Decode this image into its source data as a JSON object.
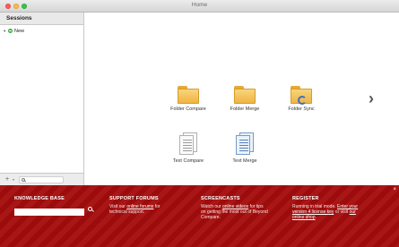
{
  "window": {
    "title": "Home"
  },
  "sidebar": {
    "header": "Sessions",
    "tree": [
      {
        "label": "New",
        "expanded": true
      }
    ],
    "bottom": {
      "add_label": "+",
      "search_placeholder": ""
    }
  },
  "launcher": {
    "items": [
      {
        "label": "Folder Compare",
        "icon": "folder-icon"
      },
      {
        "label": "Folder Merge",
        "icon": "folder-icon"
      },
      {
        "label": "Folder Sync",
        "icon": "folder-sync-icon"
      },
      {
        "label": "Text Compare",
        "icon": "text-doc-icon"
      },
      {
        "label": "Text Merge",
        "icon": "text-doc-icon"
      }
    ],
    "next_icon": "chevron-right-icon"
  },
  "footer": {
    "knowledge_base": {
      "heading": "KNOWLEDGE BASE",
      "search_value": ""
    },
    "support": {
      "heading": "SUPPORT FORUMS",
      "text_before": "Visit our ",
      "link": "online forums",
      "text_after": " for technical support."
    },
    "screencasts": {
      "heading": "SCREENCASTS",
      "text_before": "Watch our ",
      "link": "online videos",
      "text_after": " for tips on getting the most out of Beyond Compare."
    },
    "register": {
      "heading": "REGISTER",
      "text_before": "Running in trial mode. ",
      "link1": "Enter your version 4 license key",
      "text_mid": " or visit ",
      "link2": "our online shop",
      "text_after": "."
    },
    "close_label": "×"
  },
  "colors": {
    "footer_bg": "#a50d0d",
    "folder": "#efb445",
    "accent_blue": "#3c6fc4"
  }
}
